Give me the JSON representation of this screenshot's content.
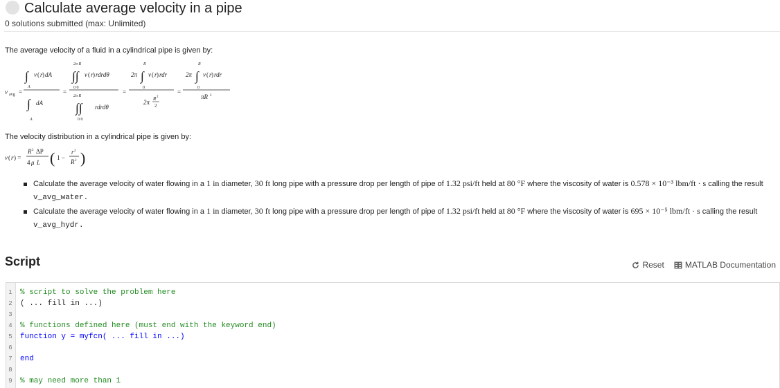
{
  "header": {
    "title": "Calculate average velocity in a pipe",
    "subtitle": "0 solutions submitted (max: Unlimited)"
  },
  "description": {
    "intro": "The average velocity of a fluid in a cylindrical pipe is given by:",
    "dist_intro": "The velocity distribution in a cylindrical pipe is given by:"
  },
  "tasks": [
    {
      "prefix": "Calculate the average velocity of water flowing in a ",
      "diam": "1 in",
      "t1": " diameter, ",
      "length": "30 ft",
      "t2": " long pipe with a pressure drop per length of pipe of ",
      "dp": "1.32 psi/ft",
      "t3": " held at ",
      "temp": "80 °F",
      "t4": " where the viscosity of water is ",
      "mu": "0.578 × 10⁻³ lbm/ft · s",
      "t5": " calling the result",
      "var": "v_avg_water."
    },
    {
      "prefix": "Calculate the average velocity of water flowing in a ",
      "diam": "1 in",
      "t1": " diameter, ",
      "length": "30 ft",
      "t2": " long pipe with a pressure drop per length of pipe of ",
      "dp": "1.32 psi/ft",
      "t3": " held at ",
      "temp": "80 °F",
      "t4": " where the viscosity of water is ",
      "mu": "695 × 10⁻⁵ lbm/ft · s",
      "t5": " calling the result",
      "var": "v_avg_hydr."
    }
  ],
  "script": {
    "heading": "Script",
    "reset_label": "Reset",
    "docs_label": "MATLAB Documentation",
    "lines": [
      {
        "n": "1",
        "text": "% script to solve the problem here"
      },
      {
        "n": "2",
        "text": "( ... fill in ...)"
      },
      {
        "n": "3",
        "text": ""
      },
      {
        "n": "4",
        "text": "% functions defined here (must end with the keyword end)"
      },
      {
        "n": "5",
        "text": "function y = myfcn( ... fill in ...)"
      },
      {
        "n": "6",
        "text": ""
      },
      {
        "n": "7",
        "text": "end"
      },
      {
        "n": "8",
        "text": ""
      },
      {
        "n": "9",
        "text": "% may need more than 1"
      }
    ]
  },
  "icons": {
    "reset": "refresh-icon",
    "docs": "documentation-icon"
  }
}
